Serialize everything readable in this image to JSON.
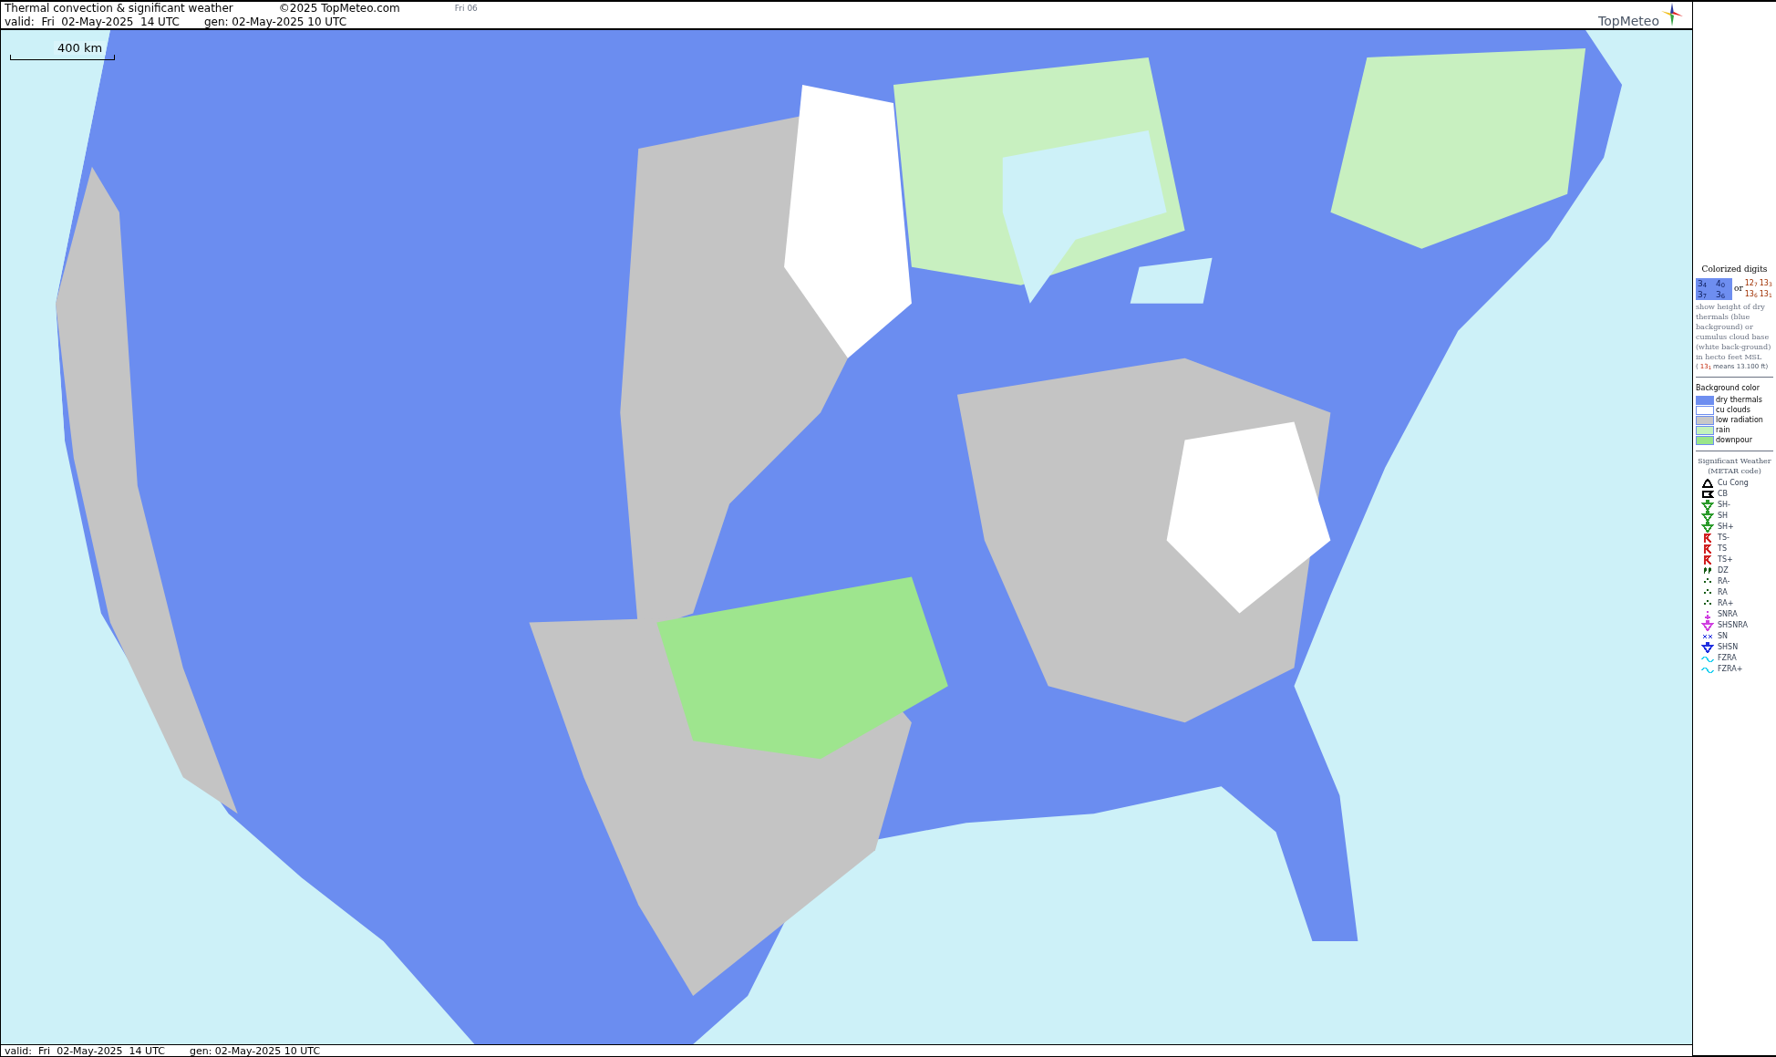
{
  "header": {
    "title": "Thermal convection & significant weather",
    "copyright": "©2025 TopMeteo.com",
    "frame": "Fri 06",
    "valid": "valid:  Fri  02-May-2025  14 UTC",
    "generated": "gen: 02-May-2025 10 UTC",
    "logo": "TopMeteo"
  },
  "map": {
    "kind": "picture",
    "scale": "400 km"
  },
  "legend": {
    "digits_title": "Colorized digits",
    "blue_samples": [
      "3$_{4}$",
      "4$_{0}$",
      "3$_{7}$",
      "3$_{6}$"
    ],
    "or": "or",
    "white_samples": [
      "12$_{7}$",
      "13$_{3}$",
      "13$_{6}$",
      "13$_{1}$"
    ],
    "description": "show height of dry thermals (blue background) or cumulus cloud base (white back-ground) in hecto feet MSL",
    "example_open": "(",
    "example": "13$_{1}$",
    "example_text": "means 13.100 ft)",
    "background_title": "Background color",
    "backgrounds": [
      {
        "label": "dry thermals",
        "color": "#6e8ef0"
      },
      {
        "label": "cu clouds",
        "color": "#ffffff"
      },
      {
        "label": "low radiation",
        "color": "#c8c8c8"
      },
      {
        "label": "rain",
        "color": "#c4f2bc"
      },
      {
        "label": "downpour",
        "color": "#9ae58a"
      }
    ],
    "weather_title": "Significant Weather",
    "weather_subtitle": "(METAR code)",
    "symbols": [
      {
        "kind": "cucong",
        "label": "Cu Cong",
        "color": "#000000"
      },
      {
        "kind": "cb",
        "label": "CB",
        "color": "#000000"
      },
      {
        "kind": "shower",
        "label": "SH-",
        "color": "#2a9a2a"
      },
      {
        "kind": "shower",
        "label": "SH",
        "color": "#2a9a2a"
      },
      {
        "kind": "shower",
        "label": "SH+",
        "color": "#2a9a2a"
      },
      {
        "kind": "thunder",
        "label": "TS-",
        "color": "#d02020"
      },
      {
        "kind": "thunder",
        "label": "TS",
        "color": "#d02020"
      },
      {
        "kind": "thunder",
        "label": "TS+",
        "color": "#d02020"
      },
      {
        "kind": "drizzle",
        "label": "DZ",
        "color": "#145a14"
      },
      {
        "kind": "rain",
        "label": "RA-",
        "color": "#145a14"
      },
      {
        "kind": "rain",
        "label": "RA",
        "color": "#145a14"
      },
      {
        "kind": "rain",
        "label": "RA+",
        "color": "#145a14"
      },
      {
        "kind": "snowrain",
        "label": "SNRA",
        "color": "#d040e0"
      },
      {
        "kind": "shower",
        "label": "SHSNRA",
        "color": "#d040e0"
      },
      {
        "kind": "snow",
        "label": "SN",
        "color": "#2030e0"
      },
      {
        "kind": "shower",
        "label": "SHSN",
        "color": "#2030e0"
      },
      {
        "kind": "freezing",
        "label": "FZRA",
        "color": "#20d0f0"
      },
      {
        "kind": "freezing",
        "label": "FZRA+",
        "color": "#20d0f0"
      }
    ]
  },
  "footer": {
    "valid": "valid:  Fri  02-May-2025  14 UTC",
    "generated": "gen: 02-May-2025 10 UTC"
  }
}
